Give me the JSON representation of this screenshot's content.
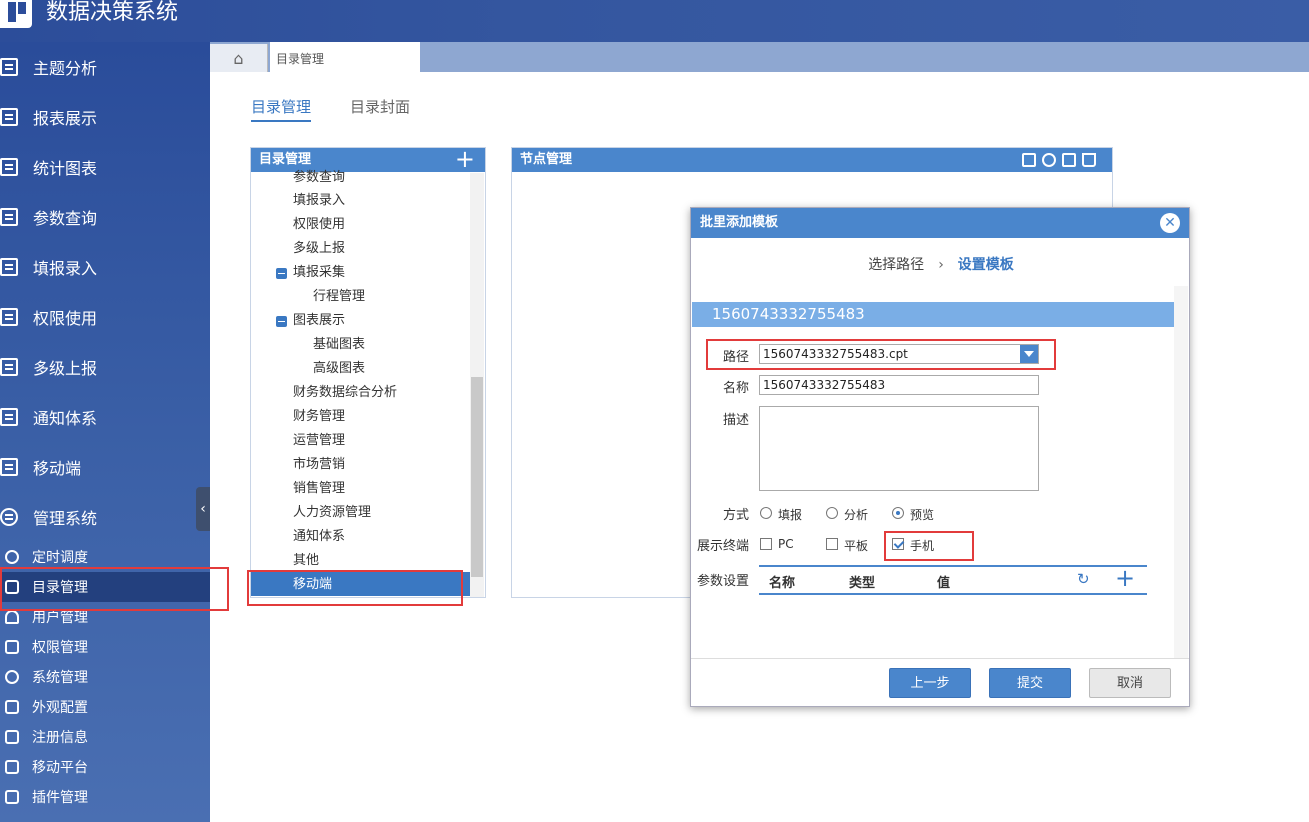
{
  "app": {
    "title": "数据决策系统"
  },
  "sidebar": {
    "main_items": [
      {
        "label": "主题分析"
      },
      {
        "label": "报表展示"
      },
      {
        "label": "统计图表"
      },
      {
        "label": "参数查询"
      },
      {
        "label": "填报录入"
      },
      {
        "label": "权限使用"
      },
      {
        "label": "多级上报"
      },
      {
        "label": "通知体系"
      },
      {
        "label": "移动端"
      },
      {
        "label": "管理系统"
      }
    ],
    "sub_items": [
      {
        "label": "定时调度"
      },
      {
        "label": "目录管理"
      },
      {
        "label": "用户管理"
      },
      {
        "label": "权限管理"
      },
      {
        "label": "系统管理"
      },
      {
        "label": "外观配置"
      },
      {
        "label": "注册信息"
      },
      {
        "label": "移动平台"
      },
      {
        "label": "插件管理"
      }
    ],
    "active_sub": "目录管理"
  },
  "tabs": {
    "page_tab": "目录管理"
  },
  "subtabs": {
    "directory": "目录管理",
    "cover": "目录封面"
  },
  "dir_panel": {
    "title": "目录管理",
    "tree": [
      {
        "label": "参数查询"
      },
      {
        "label": "填报录入"
      },
      {
        "label": "权限使用"
      },
      {
        "label": "多级上报"
      },
      {
        "label": "填报采集"
      },
      {
        "label": "行程管理"
      },
      {
        "label": "图表展示"
      },
      {
        "label": "基础图表"
      },
      {
        "label": "高级图表"
      },
      {
        "label": "财务数据综合分析"
      },
      {
        "label": "财务管理"
      },
      {
        "label": "运营管理"
      },
      {
        "label": "市场营销"
      },
      {
        "label": "销售管理"
      },
      {
        "label": "人力资源管理"
      },
      {
        "label": "通知体系"
      },
      {
        "label": "其他"
      },
      {
        "label": "移动端"
      }
    ]
  },
  "node_panel": {
    "title": "节点管理"
  },
  "dialog": {
    "title": "批里添加模板",
    "step1": "选择路径",
    "step_arrow": "›",
    "step2": "设置模板",
    "template_id": "1560743332755483",
    "labels": {
      "path": "路径",
      "name": "名称",
      "desc": "描述",
      "mode": "方式",
      "terminal": "展示终端",
      "params": "参数设置"
    },
    "path_value": "1560743332755483.cpt",
    "name_value": "1560743332755483",
    "desc_value": "",
    "mode_options": [
      {
        "label": "填报",
        "checked": false
      },
      {
        "label": "分析",
        "checked": false
      },
      {
        "label": "预览",
        "checked": true
      }
    ],
    "terminal_options": [
      {
        "label": "PC",
        "checked": false
      },
      {
        "label": "平板",
        "checked": false
      },
      {
        "label": "手机",
        "checked": true
      }
    ],
    "param_columns": {
      "name": "名称",
      "type": "类型",
      "value": "值"
    },
    "buttons": {
      "prev": "上一步",
      "submit": "提交",
      "cancel": "取消"
    }
  },
  "colors": {
    "accent": "#4a86cc",
    "highlight": "#e23b3b"
  }
}
